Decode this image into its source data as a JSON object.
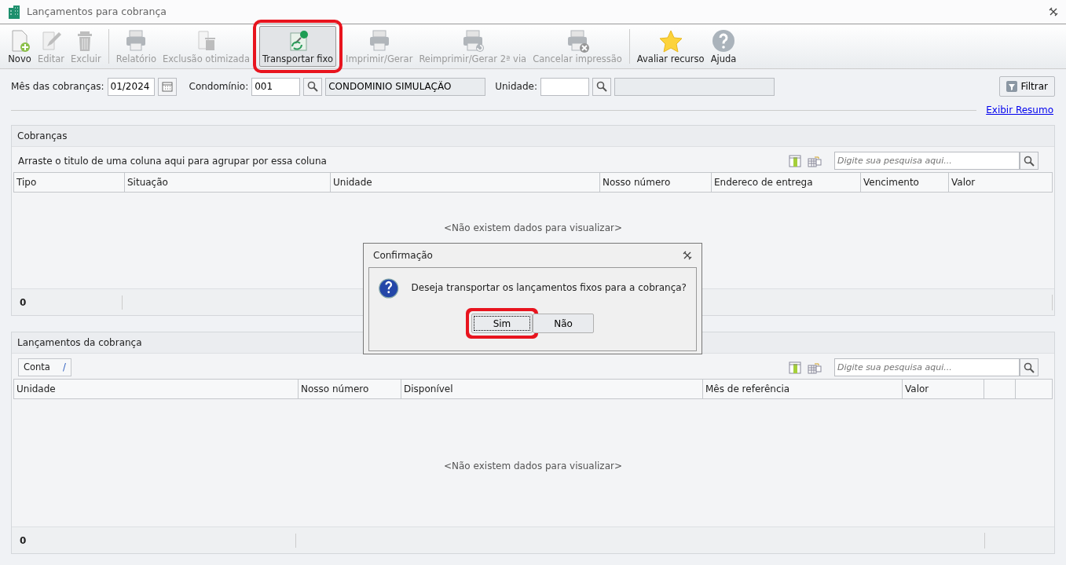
{
  "window": {
    "title": "Lançamentos para cobrança"
  },
  "toolbar": [
    {
      "kind": "new",
      "label": "Novo",
      "disabled": false,
      "highlighted": false,
      "separator_after": false
    },
    {
      "kind": "edit",
      "label": "Editar",
      "disabled": true,
      "highlighted": false,
      "separator_after": false
    },
    {
      "kind": "delete",
      "label": "Excluir",
      "disabled": true,
      "highlighted": false,
      "separator_after": true
    },
    {
      "kind": "print",
      "label": "Relatório",
      "disabled": true,
      "highlighted": false,
      "separator_after": false
    },
    {
      "kind": "docdelete",
      "label": "Exclusão otimizada",
      "disabled": true,
      "highlighted": false,
      "separator_after": false
    },
    {
      "kind": "pin",
      "label": "Transportar fixo",
      "disabled": false,
      "highlighted": true,
      "separator_after": false
    },
    {
      "kind": "print",
      "label": "Imprimir/Gerar",
      "disabled": true,
      "highlighted": false,
      "separator_after": false
    },
    {
      "kind": "reprint",
      "label": "Reimprimir/Gerar 2ª via",
      "disabled": true,
      "highlighted": false,
      "separator_after": false
    },
    {
      "kind": "cancelprint",
      "label": "Cancelar impressão",
      "disabled": true,
      "highlighted": false,
      "separator_after": true
    },
    {
      "kind": "star",
      "label": "Avaliar recurso",
      "disabled": false,
      "highlighted": false,
      "separator_after": false
    },
    {
      "kind": "help",
      "label": "Ajuda",
      "disabled": false,
      "highlighted": false,
      "separator_after": false
    }
  ],
  "filters": {
    "month_label": "Mês das cobranças:",
    "month_value": "01/2024",
    "condo_label": "Condomínio:",
    "condo_code": "001",
    "condo_name": "CONDOMINIO SIMULAÇÃO",
    "unit_label": "Unidade:",
    "filter_button": "Filtrar",
    "summary_link": "Exibir Resumo"
  },
  "panels": [
    {
      "title": "Cobranças",
      "group_hint": "Arraste o titulo de uma coluna aqui para agrupar por essa coluna",
      "search_placeholder": "Digite sua pesquisa aqui...",
      "columns": [
        "Tipo",
        "Situação",
        "Unidade",
        "Nosso número",
        "Endereco de entrega",
        "Vencimento",
        "Valor"
      ],
      "empty_text": "<Não existem dados para visualizar>",
      "footer_count": "0"
    },
    {
      "title": "Lançamentos da cobrança",
      "group_chip": "Conta",
      "chip_mark": "/",
      "search_placeholder": "Digite sua pesquisa aqui...",
      "columns": [
        "Unidade",
        "Nosso número",
        "Disponível",
        "Mês de referência",
        "Valor",
        "",
        ""
      ],
      "empty_text": "<Não existem dados para visualizar>",
      "footer_count": "0"
    }
  ],
  "dialog": {
    "title": "Confirmação",
    "message": "Deseja transportar os lançamentos fixos para a cobrança?",
    "buttons": [
      {
        "label": "Sim",
        "focused": true,
        "highlighted": true
      },
      {
        "label": "Não",
        "focused": false,
        "highlighted": false
      }
    ]
  }
}
